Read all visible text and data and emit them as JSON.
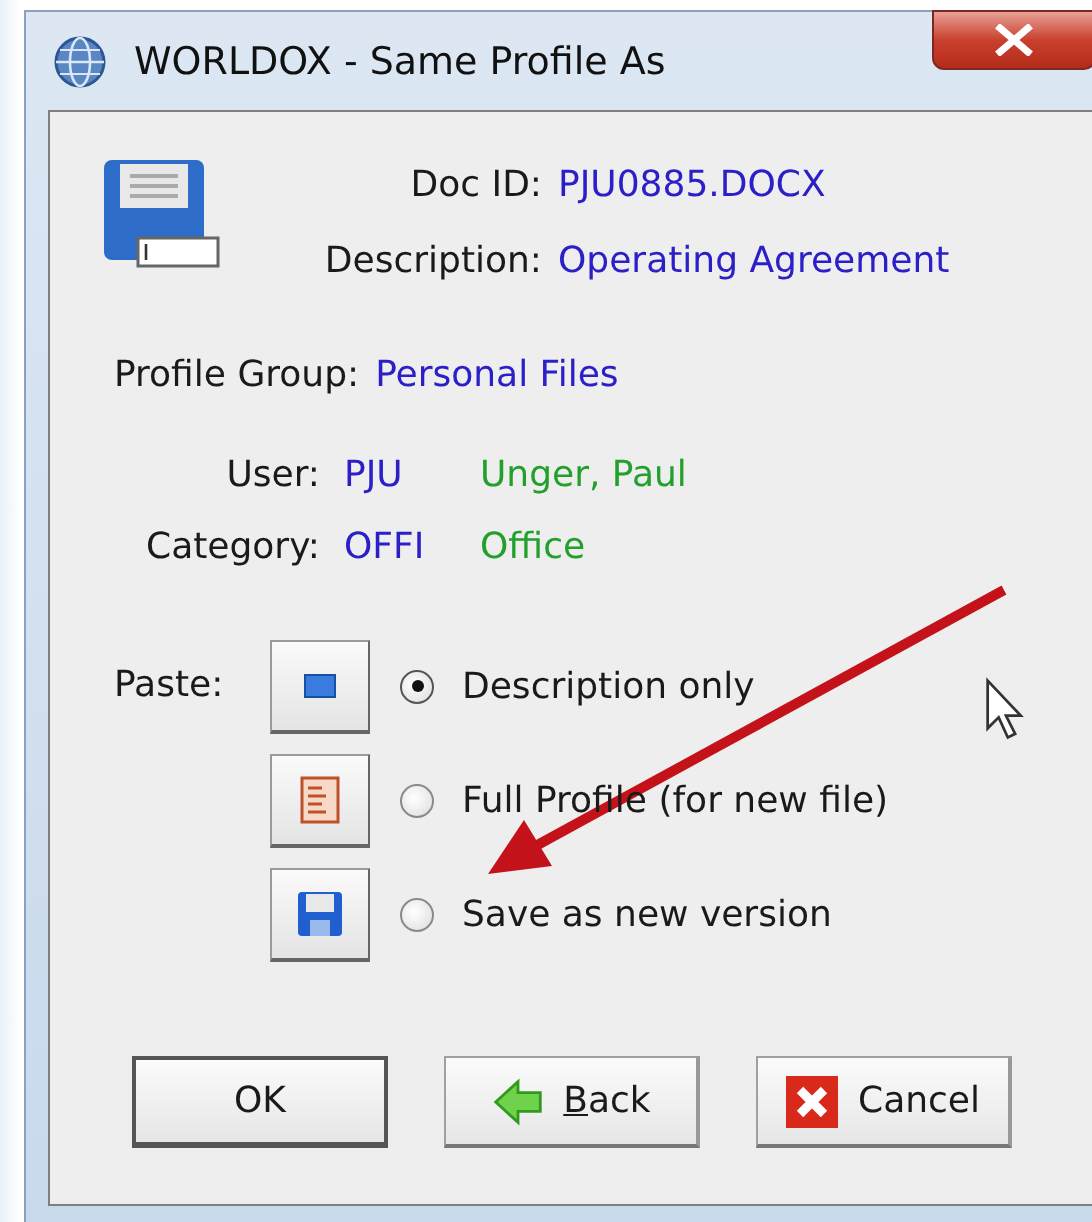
{
  "window": {
    "title": "WORLDOX - Same Profile As"
  },
  "document": [
    {
      "label": "Doc ID:",
      "value": "PJU0885.DOCX"
    },
    {
      "label": "Description:",
      "value": "Operating Agreement"
    }
  ],
  "profile_group": {
    "label": "Profile Group:",
    "value": "Personal Files"
  },
  "fields": [
    {
      "label": "User:",
      "code": "PJU",
      "name": "Unger, Paul"
    },
    {
      "label": "Category:",
      "code": "OFFI",
      "name": "Office"
    }
  ],
  "paste": {
    "label": "Paste:",
    "options": [
      {
        "kind": "description",
        "label": "Description only",
        "selected": true
      },
      {
        "kind": "full",
        "label": "Full Profile (for new file)",
        "selected": false
      },
      {
        "kind": "version",
        "label": "Save as new version",
        "selected": false
      }
    ]
  },
  "buttons": [
    {
      "kind": "ok",
      "label": "OK",
      "mnemonic_underlined": false
    },
    {
      "kind": "back",
      "label": "Back",
      "mnemonic_underlined": true
    },
    {
      "kind": "cancel",
      "label": "Cancel",
      "mnemonic_underlined": false
    }
  ]
}
